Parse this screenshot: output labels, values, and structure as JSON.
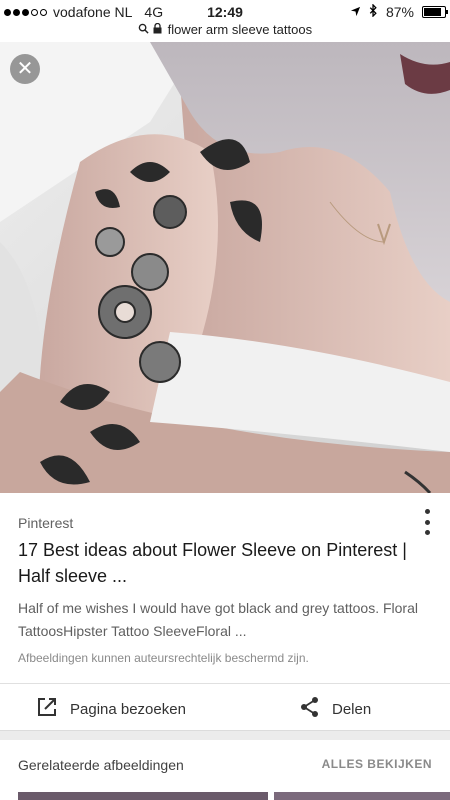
{
  "status": {
    "carrier": "vodafone NL",
    "network": "4G",
    "time": "12:49",
    "battery": "87%",
    "battery_level": 0.87,
    "url": "flower arm sleeve tattoos"
  },
  "image": {
    "description_icon": "tattoo-photo"
  },
  "card": {
    "source": "Pinterest",
    "title": "17 Best ideas about Flower Sleeve on Pinterest | Half sleeve ...",
    "description": "Half of me wishes I would have got black and grey tattoos. Floral TattoosHipster Tattoo SleeveFloral ...",
    "copyright": "Afbeeldingen kunnen auteursrechtelijk beschermd zijn.",
    "visit_label": "Pagina bezoeken",
    "share_label": "Delen"
  },
  "related": {
    "title": "Gerelateerde afbeeldingen",
    "view_all": "ALLES BEKIJKEN"
  },
  "colors": {
    "accent": "#212121",
    "muted": "#8a8a8a"
  }
}
